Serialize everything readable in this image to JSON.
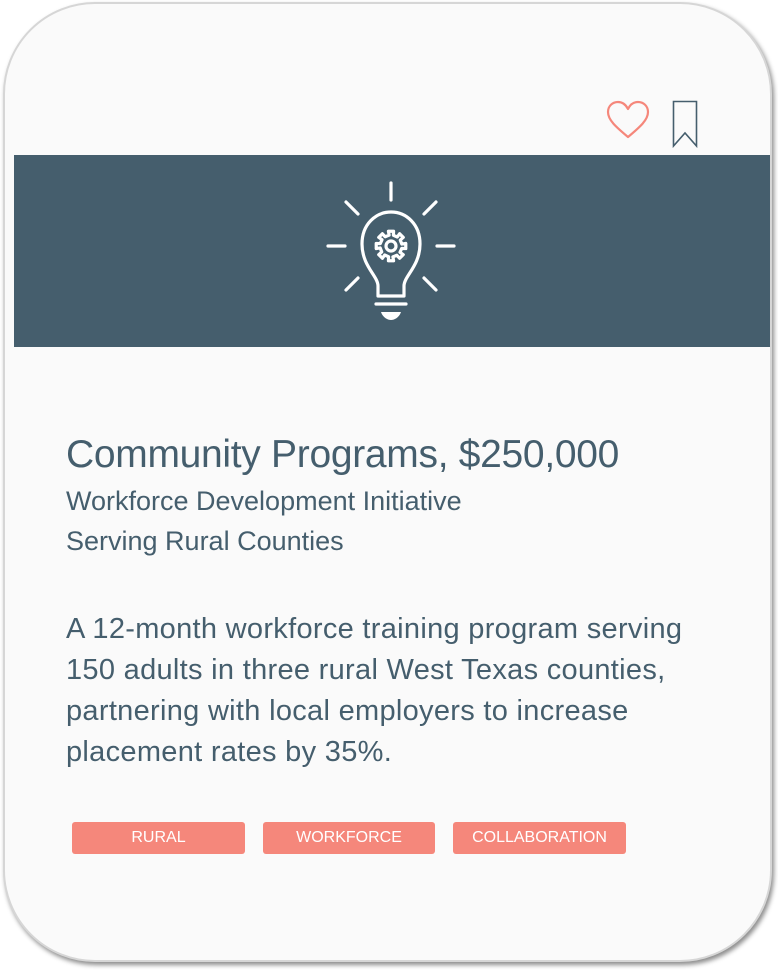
{
  "theme": {
    "banner_color": "#455e6d",
    "accent_color": "#f5877b",
    "text_color": "#455e6d",
    "bookmark_color": "#455e6d"
  },
  "card": {
    "banner_icon": "lightbulb-gear-icon",
    "favorite_icon": "heart-outline-icon",
    "bookmark_icon": "bookmark-outline-icon",
    "title": "Community Programs, $250,000",
    "subtitle_line1": "Workforce Development Initiative",
    "subtitle_line2": "Serving Rural Counties",
    "description": "A 12-month workforce training program serving 150 adults in three rural West Texas counties, partnering with local employers to increase placement rates by 35%.",
    "tags": [
      "RURAL",
      "WORKFORCE",
      "COLLABORATION"
    ]
  }
}
